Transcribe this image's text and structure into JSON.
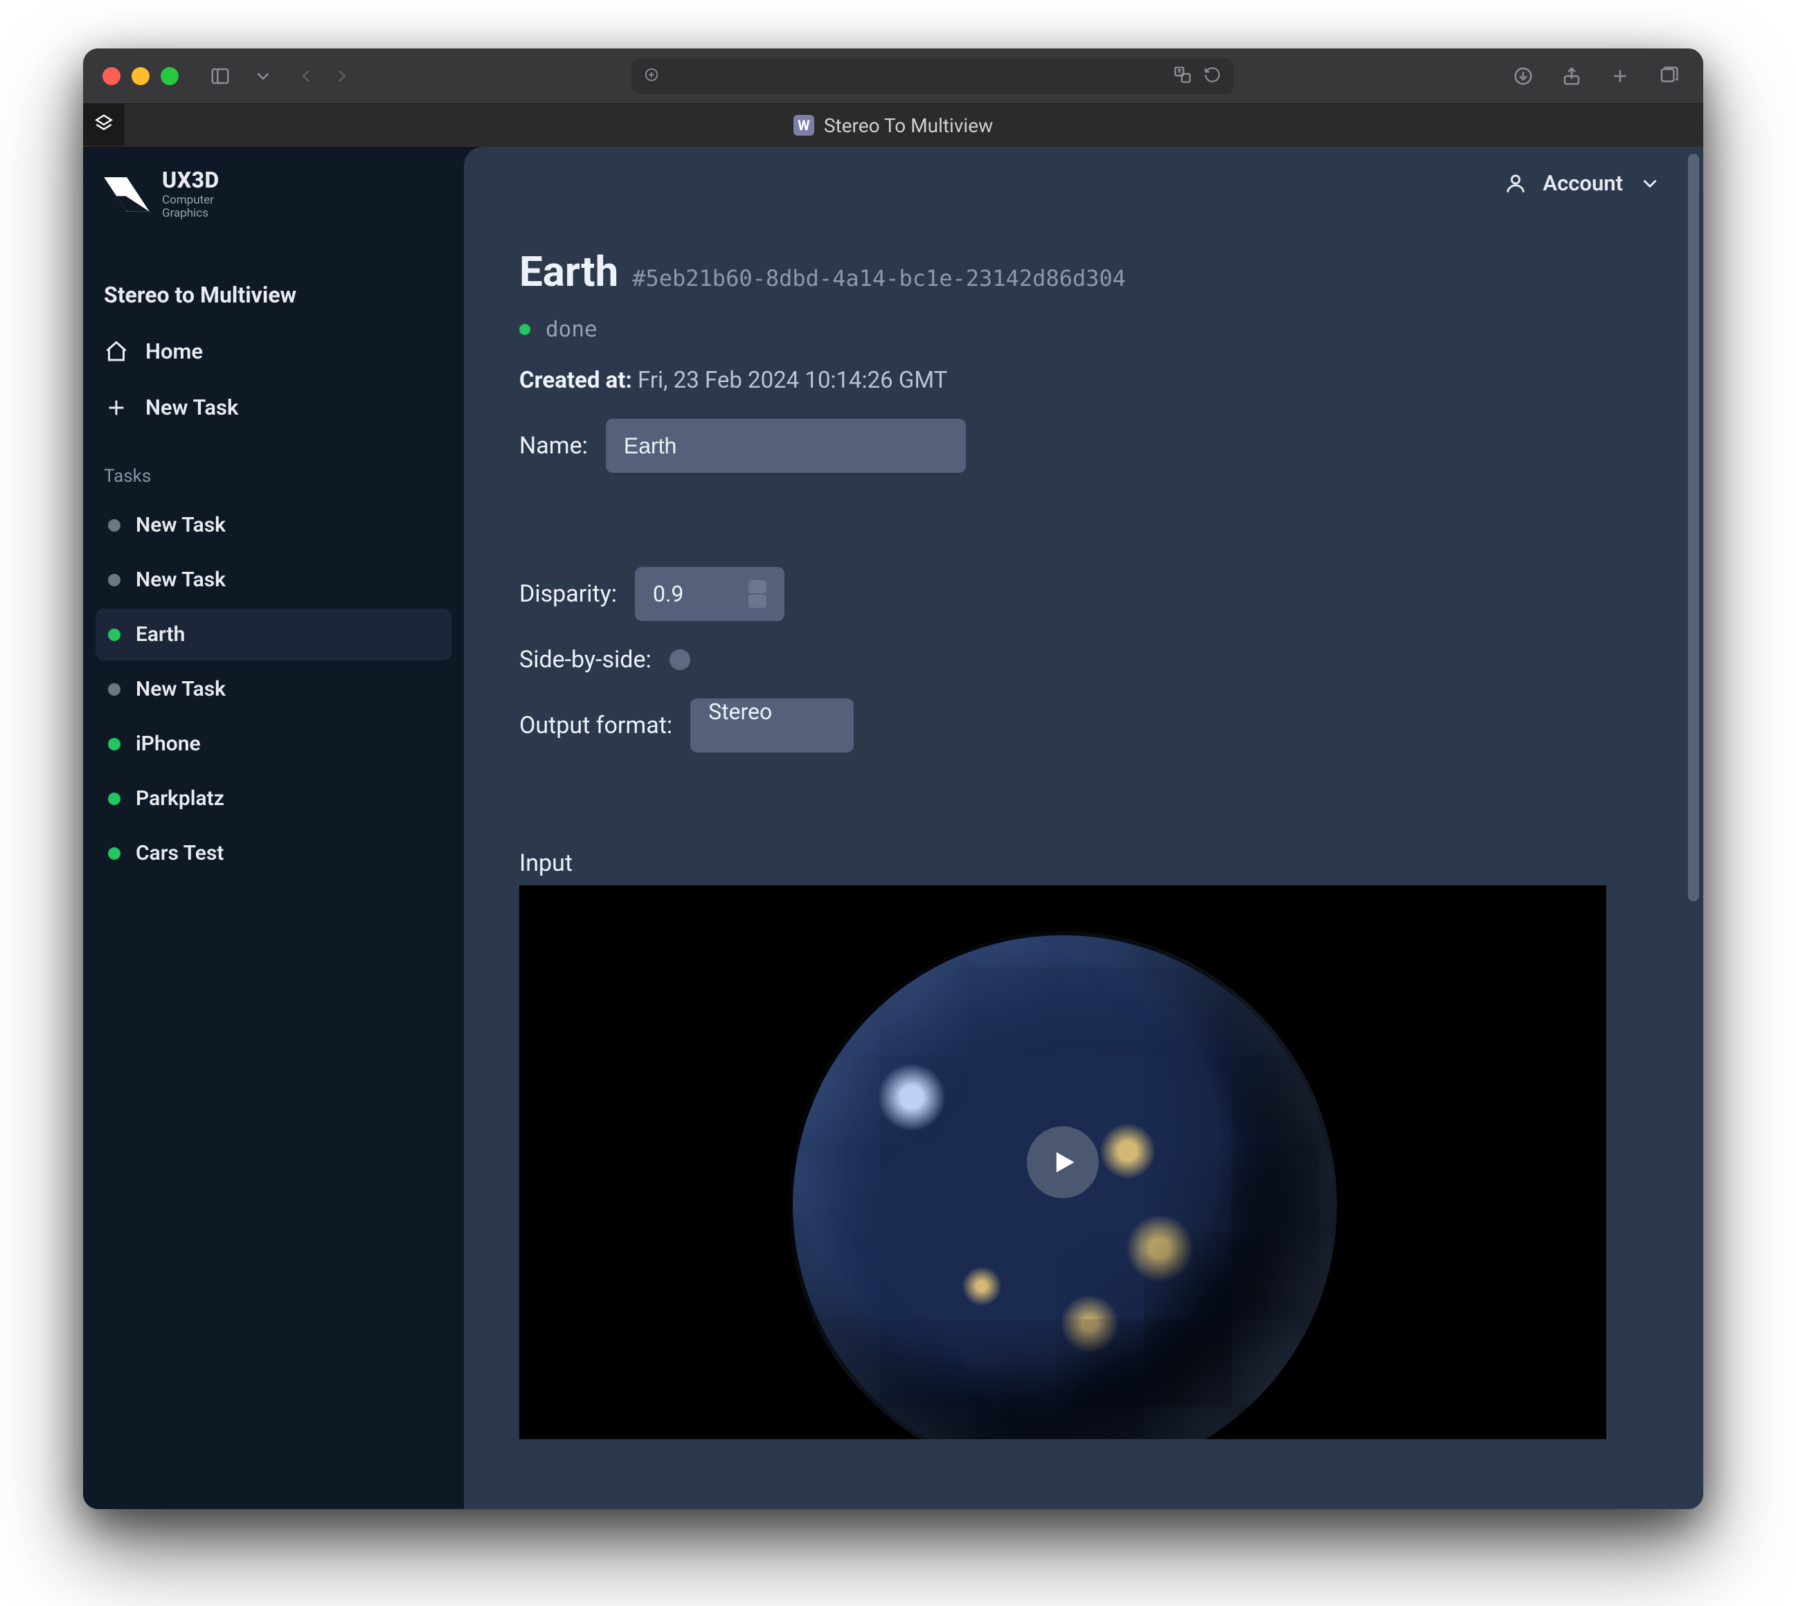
{
  "browser": {
    "tab_title": "Stereo To Multiview",
    "tab_badge": "W"
  },
  "brand": {
    "name": "UX3D",
    "subline1": "Computer",
    "subline2": "Graphics"
  },
  "sidebar": {
    "app_title": "Stereo to Multiview",
    "home": "Home",
    "new_task": "New Task",
    "tasks_label": "Tasks",
    "tasks": [
      {
        "label": "New Task",
        "status": "grey",
        "active": false
      },
      {
        "label": "New Task",
        "status": "grey",
        "active": false
      },
      {
        "label": "Earth",
        "status": "green",
        "active": true
      },
      {
        "label": "New Task",
        "status": "grey",
        "active": false
      },
      {
        "label": "iPhone",
        "status": "green",
        "active": false
      },
      {
        "label": "Parkplatz",
        "status": "green",
        "active": false
      },
      {
        "label": "Cars Test",
        "status": "green",
        "active": false
      }
    ]
  },
  "header": {
    "account": "Account"
  },
  "task": {
    "title": "Earth",
    "hash": "#5eb21b60-8dbd-4a14-bc1e-23142d86d304",
    "status_text": "done",
    "created_at_label": "Created at:",
    "created_at_value": "Fri, 23 Feb 2024 10:14:26 GMT",
    "name_label": "Name:",
    "name_value": "Earth",
    "disparity_label": "Disparity:",
    "disparity_value": "0.9",
    "sbs_label": "Side-by-side:",
    "sbs_checked": false,
    "output_format_label": "Output format:",
    "output_format_value": "Stereo",
    "input_label": "Input"
  }
}
